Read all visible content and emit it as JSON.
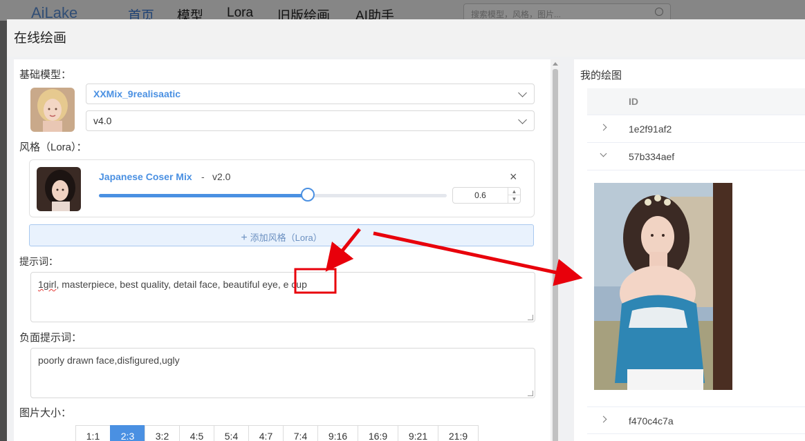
{
  "topnav": {
    "logo": "AiLake",
    "items": [
      "首页",
      "模型",
      "Lora",
      "旧版绘画",
      "AI助手"
    ],
    "search_placeholder": "搜索模型，风格，图片..."
  },
  "dialog": {
    "title": "在线绘画"
  },
  "form": {
    "base_model_label": "基础模型：",
    "model_name": "XXMix_9realisaatic",
    "model_version": "v4.0",
    "lora_label": "风格（Lora）：",
    "lora": {
      "name": "Japanese Coser Mix",
      "sep": "-",
      "version": "v2.0",
      "weight": "0.6",
      "weight_fraction": 0.6,
      "close": "×"
    },
    "add_lora": "添加风格（Lora）",
    "prompt_label": "提示词：",
    "prompt_first": "1girl",
    "prompt_rest": ", masterpiece, best quality, detail face, beautiful eye, e cup",
    "negative_label": "负面提示词：",
    "negative_prompt": "poorly drawn face,disfigured,ugly",
    "size_label": "图片大小：",
    "ratios": [
      "1:1",
      "2:3",
      "3:2",
      "4:5",
      "5:4",
      "4:7",
      "7:4",
      "9:16",
      "16:9",
      "9:21",
      "21:9"
    ],
    "ratio_selected": "2:3"
  },
  "history": {
    "title": "我的绘图",
    "column_id": "ID",
    "rows": [
      {
        "id": "1e2f91af2",
        "expanded": false
      },
      {
        "id": "57b334aef",
        "expanded": true
      },
      {
        "id": "f470c4c7a",
        "expanded": false
      }
    ]
  },
  "colors": {
    "accent": "#4a90e2",
    "annotation": "#e8000b"
  }
}
